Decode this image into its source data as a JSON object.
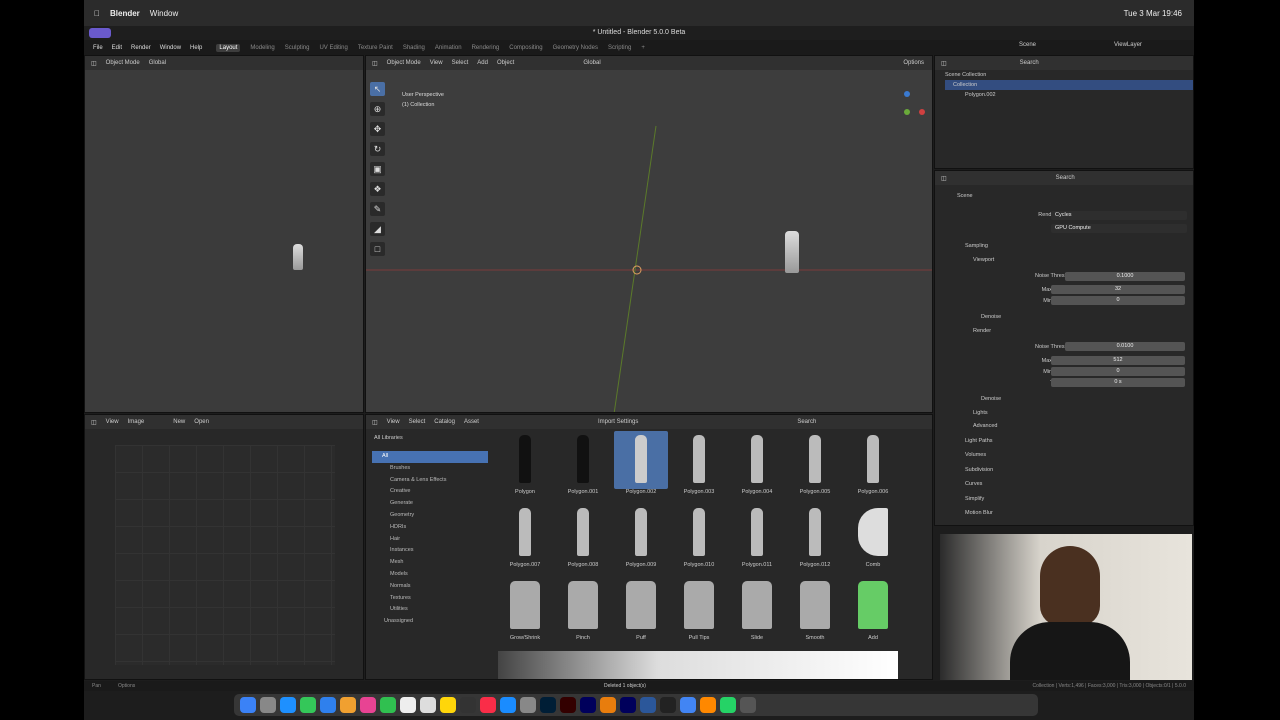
{
  "menubar": {
    "app": "Blender",
    "window": "Window",
    "datetime": "Tue 3 Mar 19:46"
  },
  "title": "* Untitled - Blender 5.0.0 Beta",
  "topmenu": [
    "File",
    "Edit",
    "Render",
    "Window",
    "Help"
  ],
  "workspaces": [
    "Layout",
    "Modeling",
    "Sculpting",
    "UV Editing",
    "Texture Paint",
    "Shading",
    "Animation",
    "Rendering",
    "Compositing",
    "Geometry Nodes",
    "Scripting"
  ],
  "viewport": {
    "mode": "Object Mode",
    "menus": [
      "View",
      "Select",
      "Add",
      "Object"
    ],
    "orientation": "Global",
    "perspective": "User Perspective",
    "collection": "(1) Collection",
    "options": "Options",
    "search_placeholder": "Search"
  },
  "left_vp": {
    "mode": "Object Mode",
    "orientation": "Global"
  },
  "image_editor": {
    "menus": [
      "View",
      "Image"
    ],
    "new": "New",
    "open": "Open"
  },
  "asset_browser": {
    "menus": [
      "View",
      "Select",
      "Catalog",
      "Asset"
    ],
    "import": "Import Settings",
    "library": "All Libraries",
    "search_placeholder": "Search",
    "tree": [
      "All",
      "Brushes",
      "Camera & Lens Effects",
      "Creative",
      "Generate",
      "Geometry",
      "HDRIs",
      "Hair",
      "Instances",
      "Mesh",
      "Models",
      "Normals",
      "Textures",
      "Utilities",
      "Unassigned"
    ],
    "row1": [
      "Polygon",
      "Polygon.001",
      "Polygon.002",
      "Polygon.003",
      "Polygon.004",
      "Polygon.005",
      "Polygon.006"
    ],
    "row2": [
      "Polygon.007",
      "Polygon.008",
      "Polygon.009",
      "Polygon.010",
      "Polygon.011",
      "Polygon.012",
      "Comb"
    ],
    "row3": [
      "Grow/Shrink",
      "Pinch",
      "Puff",
      "Pull Tips",
      "Slide",
      "Smooth",
      "Add"
    ]
  },
  "outliner": {
    "scene": "Scene",
    "viewlayer": "ViewLayer",
    "search_placeholder": "Search",
    "items": [
      "Scene Collection",
      "Collection",
      "Polygon.002"
    ]
  },
  "properties": {
    "search_placeholder": "Search",
    "scene": "Scene",
    "render_engine_label": "Render Engine",
    "render_engine": "Cycles",
    "device_label": "Device",
    "device": "GPU Compute",
    "sampling": "Sampling",
    "viewport": "Viewport",
    "noise_label": "Noise Threshold",
    "vp_noise": "0.1000",
    "max_label": "Max Samples",
    "vp_max": "32",
    "min_label": "Min Samples",
    "vp_min": "0",
    "denoise": "Denoise",
    "render": "Render",
    "r_noise": "0.0100",
    "r_max": "512",
    "r_min": "0",
    "time_label": "Time Limit",
    "r_time": "0 s",
    "sub": [
      "Lights",
      "Advanced"
    ],
    "sections": [
      "Light Paths",
      "Volumes",
      "Subdivision",
      "Curves",
      "Simplify",
      "Motion Blur"
    ]
  },
  "status": {
    "left": "Pan",
    "options": "Options",
    "center": "Deleted 1 object(s)",
    "right": "Collection | Verts:1,496 | Faces:3,000 | Tris:3,000 | Objects:0/1 | 5.0.0"
  }
}
